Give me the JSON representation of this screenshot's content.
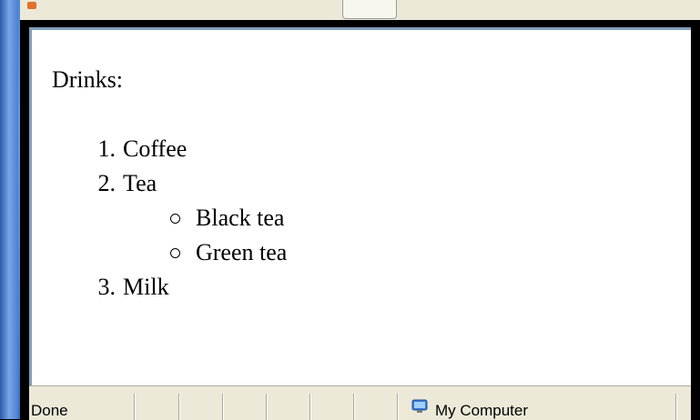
{
  "content": {
    "heading": "Drinks:",
    "list": [
      {
        "number": "1.",
        "label": "Coffee"
      },
      {
        "number": "2.",
        "label": "Tea",
        "sublist": [
          "Black tea",
          "Green tea"
        ]
      },
      {
        "number": "3.",
        "label": "Milk"
      }
    ]
  },
  "statusbar": {
    "status": "Done",
    "zone": "My Computer"
  },
  "icons": {
    "zone_icon": "computer-icon",
    "bullet": "circle-bullet-icon"
  },
  "colors": {
    "chrome": "#ece9d8",
    "border": "#7f9db9",
    "desktop": "#5b8bd4"
  }
}
